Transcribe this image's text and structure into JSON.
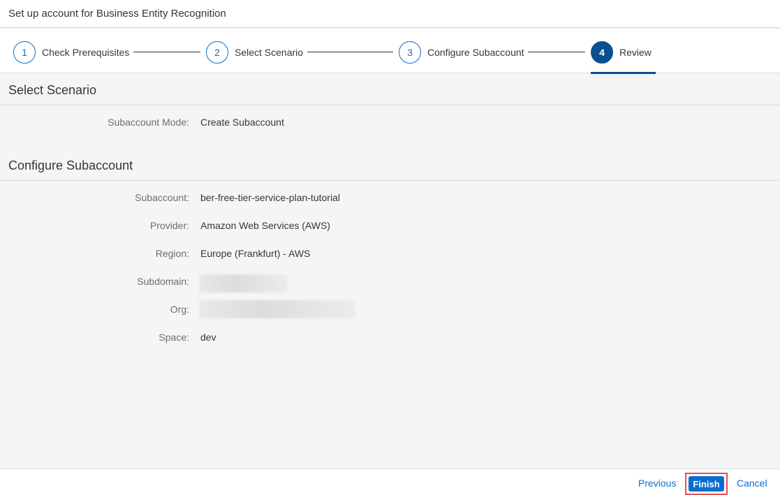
{
  "dialog": {
    "title": "Set up account for Business Entity Recognition"
  },
  "wizard": {
    "steps": [
      {
        "number": "1",
        "label": "Check Prerequisites"
      },
      {
        "number": "2",
        "label": "Select Scenario"
      },
      {
        "number": "3",
        "label": "Configure Subaccount"
      },
      {
        "number": "4",
        "label": "Review"
      }
    ]
  },
  "sections": {
    "select_scenario": {
      "title": "Select Scenario",
      "fields": [
        {
          "label": "Subaccount Mode:",
          "value": "Create Subaccount"
        }
      ]
    },
    "configure_subaccount": {
      "title": "Configure Subaccount",
      "fields": [
        {
          "label": "Subaccount:",
          "value": "ber-free-tier-service-plan-tutorial"
        },
        {
          "label": "Provider:",
          "value": "Amazon Web Services (AWS)"
        },
        {
          "label": "Region:",
          "value": "Europe (Frankfurt) - AWS"
        },
        {
          "label": "Subdomain:",
          "value": ""
        },
        {
          "label": "Org:",
          "value": ""
        },
        {
          "label": "Space:",
          "value": "dev"
        }
      ]
    }
  },
  "footer": {
    "previous_label": "Previous",
    "finish_label": "Finish",
    "cancel_label": "Cancel"
  },
  "colors": {
    "accent": "#0a6ed1",
    "active_step": "#0a4f8f",
    "highlight_border": "#e05252"
  }
}
